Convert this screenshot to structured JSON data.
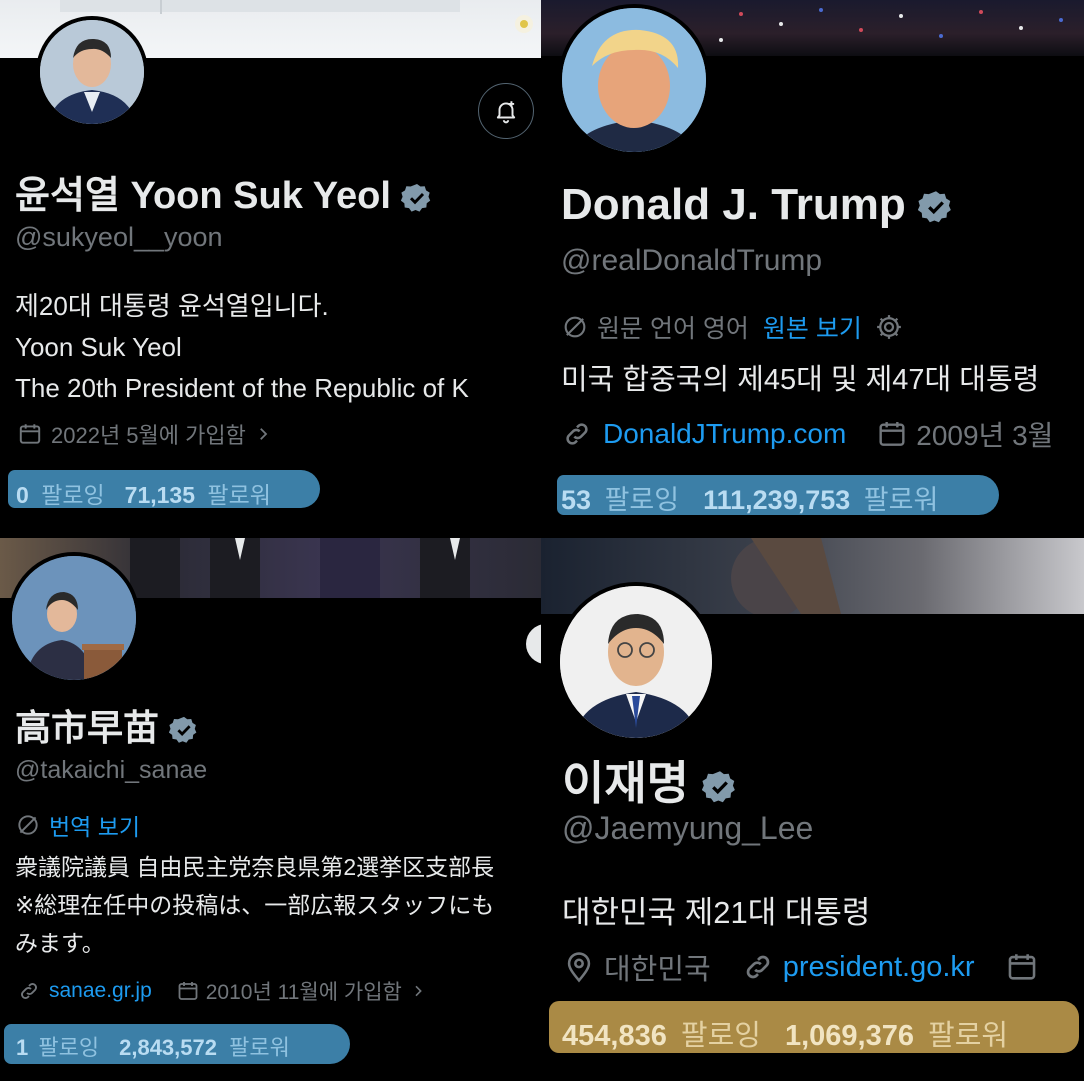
{
  "profiles": [
    {
      "name": "윤석열 Yoon Suk Yeol",
      "handle": "@sukyeol__yoon",
      "bio_lines": [
        "제20대 대통령 윤석열입니다.",
        "Yoon Suk Yeol",
        "The 20th President of the Republic of K"
      ],
      "joined": "2022년 5월에 가입함",
      "following_count": "0",
      "following_label": "팔로잉",
      "followers_count": "71,135",
      "followers_label": "팔로워",
      "highlight_color": "#4a90b8"
    },
    {
      "name": "Donald J. Trump",
      "handle": "@realDonaldTrump",
      "translate_note": "원문 언어 영어",
      "translate_link": "원본 보기",
      "bio": "미국 합중국의 제45대 및 제47대 대통령",
      "website": "DonaldJTrump.com",
      "joined": "2009년 3월",
      "following_count": "53",
      "following_label": "팔로잉",
      "followers_count": "111,239,753",
      "followers_label": "팔로워",
      "highlight_color": "#4a90b8"
    },
    {
      "name": "高市早苗",
      "handle": "@takaichi_sanae",
      "translate_link": "번역 보기",
      "bio_lines": [
        "衆議院議員 自由民主党奈良県第2選挙区支部長",
        "※総理在任中の投稿は、一部広報スタッフにも",
        "みます。"
      ],
      "website": "sanae.gr.jp",
      "joined": "2010년 11월에 가입함",
      "following_count": "1",
      "following_label": "팔로잉",
      "followers_count": "2,843,572",
      "followers_label": "팔로워",
      "highlight_color": "#4a90b8"
    },
    {
      "name": "이재명",
      "handle": "@Jaemyung_Lee",
      "bio": "대한민국 제21대 대통령",
      "location": "대한민국",
      "website": "president.go.kr",
      "following_count": "454,836",
      "following_label": "팔로잉",
      "followers_count": "1,069,376",
      "followers_label": "팔로워",
      "highlight_color": "#b8974a"
    }
  ],
  "icons": {
    "verified": "verified-badge-icon",
    "calendar": "calendar-icon",
    "link": "link-icon",
    "location": "location-pin-icon",
    "bell": "notification-bell-icon",
    "settings": "gear-icon",
    "translate": "translate-icon"
  },
  "colors": {
    "background": "#000000",
    "text": "#e7e9ea",
    "secondary": "#71767b",
    "link": "#1d9bf0",
    "verified": "#829aab"
  }
}
